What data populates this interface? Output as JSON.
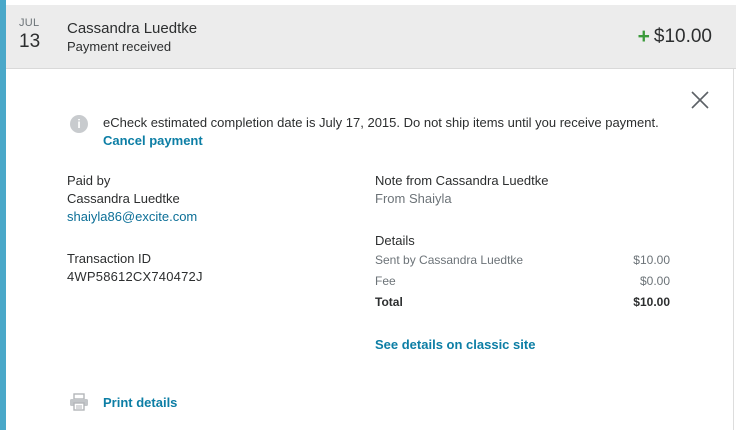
{
  "header": {
    "month": "JUL",
    "day": "13",
    "name": "Cassandra Luedtke",
    "status": "Payment received",
    "amount_sign": "+",
    "amount": "$10.00"
  },
  "notice": {
    "text": "eCheck estimated completion date is July 17, 2015. Do not ship items until you receive payment.",
    "cancel_label": "Cancel payment"
  },
  "paid_by": {
    "label": "Paid by",
    "name": "Cassandra Luedtke",
    "email": "shaiyla86@excite.com"
  },
  "transaction": {
    "label": "Transaction ID",
    "id": "4WP58612CX740472J"
  },
  "note": {
    "label": "Note from Cassandra Luedtke",
    "text": "From Shaiyla"
  },
  "details": {
    "label": "Details",
    "rows": [
      {
        "label": "Sent by Cassandra Luedtke",
        "value": "$10.00"
      },
      {
        "label": "Fee",
        "value": "$0.00"
      },
      {
        "label": "Total",
        "value": "$10.00"
      }
    ]
  },
  "links": {
    "classic_site": "See details on classic site",
    "print": "Print details"
  },
  "colors": {
    "accent": "#4aa8c9",
    "positive": "#3b9a3b",
    "link": "#0c7ea5"
  },
  "icons": {
    "info": "info-icon",
    "close": "close-icon",
    "print": "printer-icon"
  }
}
